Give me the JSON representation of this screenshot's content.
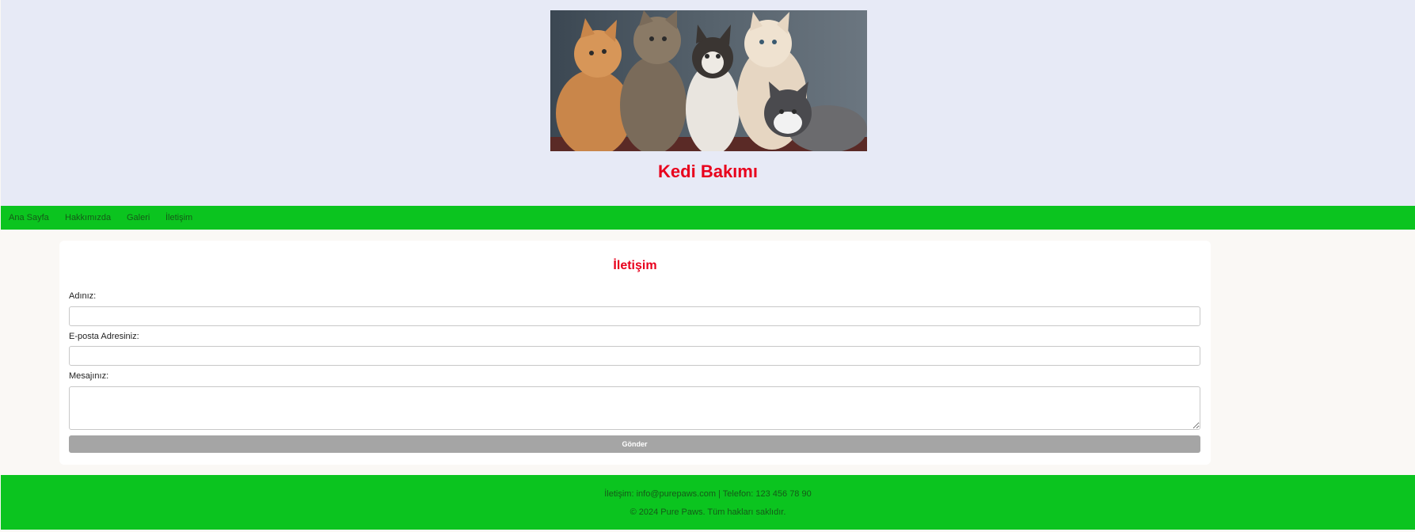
{
  "header": {
    "hero_image_alt": "kittens-photo",
    "title": "Kedi Bakımı"
  },
  "nav": {
    "items": [
      {
        "label": "Ana Sayfa"
      },
      {
        "label": "Hakkımızda"
      },
      {
        "label": "Galeri"
      },
      {
        "label": "İletişim"
      }
    ]
  },
  "contact": {
    "title": "İletişim",
    "name_label": "Adınız:",
    "name_value": "",
    "email_label": "E-posta Adresiniz:",
    "email_value": "",
    "message_label": "Mesajınız:",
    "message_value": "",
    "submit_label": "Gönder"
  },
  "footer": {
    "contact_line": "İletişim: info@purepaws.com | Telefon: 123 456 78 90",
    "copyright": "© 2024 Pure Paws. Tüm hakları saklıdır."
  },
  "colors": {
    "header_bg": "#e7eaf6",
    "accent_red": "#e8001c",
    "nav_green": "#0bc41f",
    "button_gray": "#a5a5a5",
    "page_bg": "#faf8f5"
  }
}
